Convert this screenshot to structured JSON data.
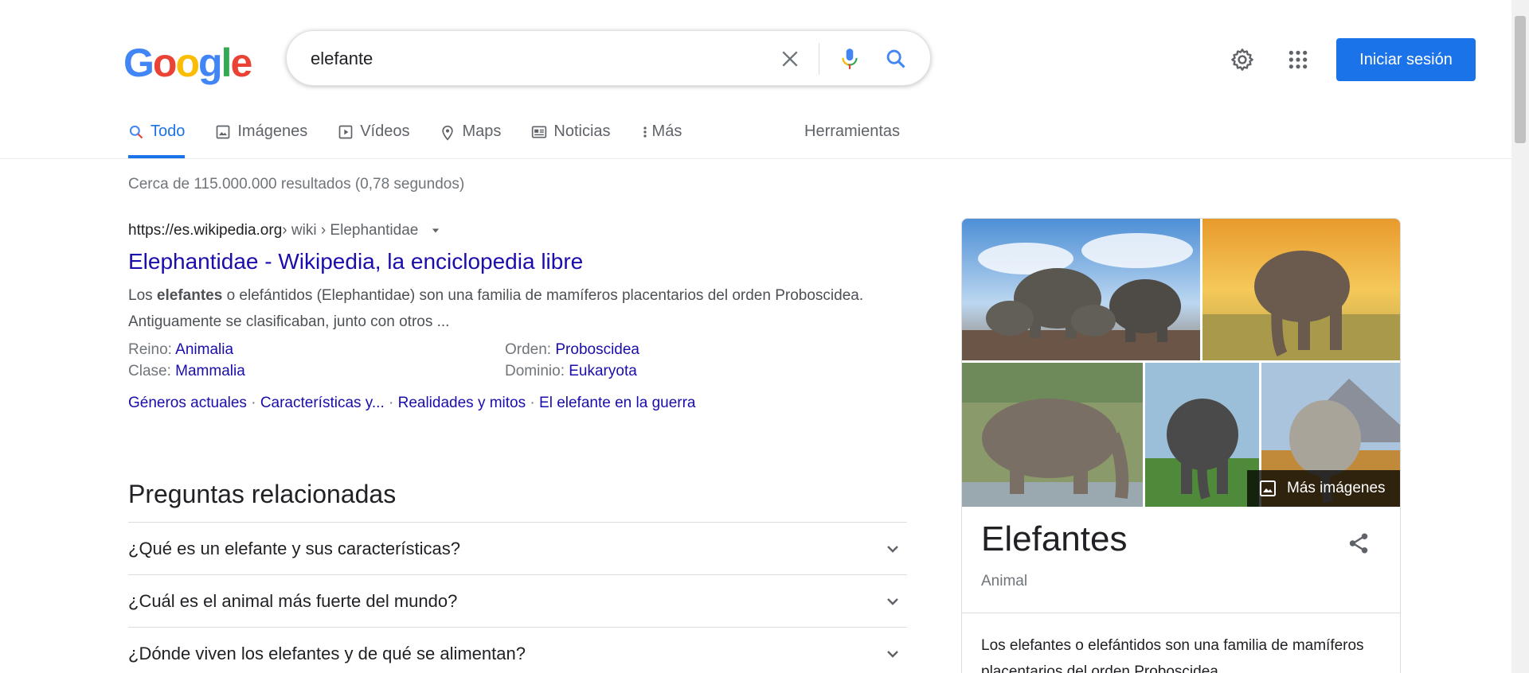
{
  "logo": {
    "letters": [
      "G",
      "o",
      "o",
      "g",
      "l",
      "e"
    ],
    "colors": [
      "#4285F4",
      "#EA4335",
      "#FBBC05",
      "#4285F4",
      "#34A853",
      "#EA4335"
    ]
  },
  "search": {
    "query": "elefante"
  },
  "header": {
    "signin_label": "Iniciar sesión"
  },
  "tabs": [
    {
      "label": "Todo",
      "icon": "search-icon",
      "active": true
    },
    {
      "label": "Imágenes",
      "icon": "image-icon"
    },
    {
      "label": "Vídeos",
      "icon": "video-icon"
    },
    {
      "label": "Maps",
      "icon": "map-pin-icon"
    },
    {
      "label": "Noticias",
      "icon": "news-icon"
    },
    {
      "label": "Más",
      "icon": "more-vert-icon"
    }
  ],
  "tools_label": "Herramientas",
  "result_stats": "Cerca de 115.000.000 resultados (0,78 segundos)",
  "result": {
    "cite_domain": "https://es.wikipedia.org",
    "cite_path": " › wiki › Elephantidae",
    "title": "Elephantidae - Wikipedia, la enciclopedia libre",
    "snippet_pre": "Los ",
    "snippet_bold": "elefantes",
    "snippet_post": " o elefántidos (Elephantidae) son una familia de mamíferos placentarios del orden Proboscidea. Antiguamente se clasificaban, junto con otros ...",
    "facts": [
      {
        "label": "Reino: ",
        "value": "Animalia"
      },
      {
        "label": "Orden: ",
        "value": "Proboscidea"
      },
      {
        "label": "Clase: ",
        "value": "Mammalia"
      },
      {
        "label": "Dominio: ",
        "value": "Eukaryota"
      }
    ],
    "sitelinks": [
      "Géneros actuales",
      "Características y...",
      "Realidades y mitos",
      "El elefante en la guerra"
    ],
    "separator": " · "
  },
  "paa": {
    "title": "Preguntas relacionadas",
    "items": [
      "¿Qué es un elefante y sus características?",
      "¿Cuál es el animal más fuerte del mundo?",
      "¿Dónde viven los elefantes y de qué se alimentan?"
    ]
  },
  "knowledge_panel": {
    "more_images": "Más imágenes",
    "title": "Elefantes",
    "subtitle": "Animal",
    "description": "Los elefantes o elefántidos son una familia de mamíferos placentarios del orden Proboscidea"
  },
  "colors": {
    "accent": "#1a73e8",
    "link": "#1a0dab"
  }
}
